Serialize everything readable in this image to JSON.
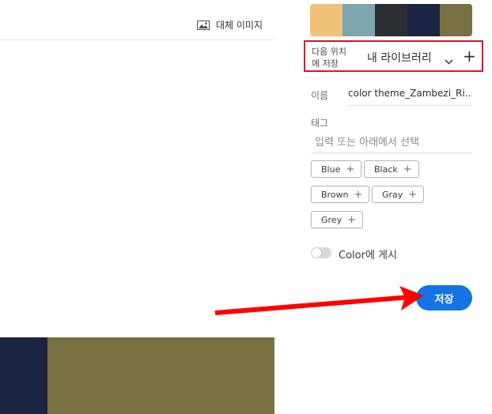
{
  "header": {
    "alt_image_label": "대체 이미지"
  },
  "palette": {
    "colors": [
      "#f1c178",
      "#7ea6ad",
      "#2a2d31",
      "#1a2541",
      "#7a7142"
    ]
  },
  "bottom_swatches": {
    "colors": [
      "#1a2541",
      "#7a7142"
    ]
  },
  "save_location": {
    "label": "다음 위치\n에 저장",
    "library": "내 라이브러리"
  },
  "name_field": {
    "label": "이름",
    "value": "color theme_Zambezi_Ri..."
  },
  "tags": {
    "label": "태그",
    "placeholder": "입력 또는 아래에서 선택",
    "chips": [
      "Blue",
      "Black",
      "Brown",
      "Gray",
      "Grey"
    ]
  },
  "publish": {
    "label": "Color에 게시",
    "enabled": false
  },
  "save_button": {
    "label": "저장"
  },
  "annotation": {
    "highlight_color": "#e0102b",
    "arrow_color": "#ff0000"
  }
}
